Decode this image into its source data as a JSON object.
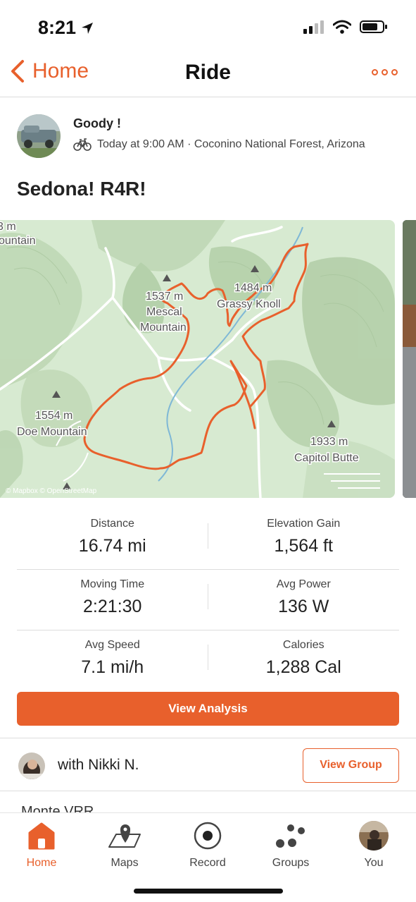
{
  "status_bar": {
    "time": "8:21"
  },
  "nav": {
    "back_label": "Home",
    "title": "Ride"
  },
  "athlete": {
    "name": "Goody !",
    "meta": "Today at 9:00 AM · Coconino National Forest, Arizona"
  },
  "activity": {
    "title": "Sedona! R4R!"
  },
  "map": {
    "labels": {
      "ridge_elev": "3 m",
      "ridge_name": "ountain",
      "mescal_elev": "1537 m",
      "mescal_name1": "Mescal",
      "mescal_name2": "Mountain",
      "grassy_elev": "1484 m",
      "grassy_name": "Grassy Knoll",
      "doe_elev": "1554 m",
      "doe_name": "Doe Mountain",
      "capitol_elev": "1933 m",
      "capitol_name": "Capitol Butte",
      "attribution": "© Mapbox © OpenStreetMap"
    },
    "route_color": "#e8602c"
  },
  "stats": [
    {
      "left": {
        "label": "Distance",
        "value": "16.74 mi"
      },
      "right": {
        "label": "Elevation Gain",
        "value": "1,564 ft"
      }
    },
    {
      "left": {
        "label": "Moving Time",
        "value": "2:21:30"
      },
      "right": {
        "label": "Avg Power",
        "value": "136 W"
      }
    },
    {
      "left": {
        "label": "Avg Speed",
        "value": "7.1 mi/h"
      },
      "right": {
        "label": "Calories",
        "value": "1,288 Cal"
      }
    }
  ],
  "actions": {
    "view_analysis": "View Analysis",
    "with_text": "with Nikki N.",
    "view_group": "View Group",
    "cutoff_text": "Monte VRR"
  },
  "tabs": [
    {
      "label": "Home",
      "icon": "home-icon",
      "active": true
    },
    {
      "label": "Maps",
      "icon": "map-icon"
    },
    {
      "label": "Record",
      "icon": "record-icon"
    },
    {
      "label": "Groups",
      "icon": "groups-icon"
    },
    {
      "label": "You",
      "icon": "avatar"
    }
  ],
  "colors": {
    "accent": "#e8602c"
  }
}
